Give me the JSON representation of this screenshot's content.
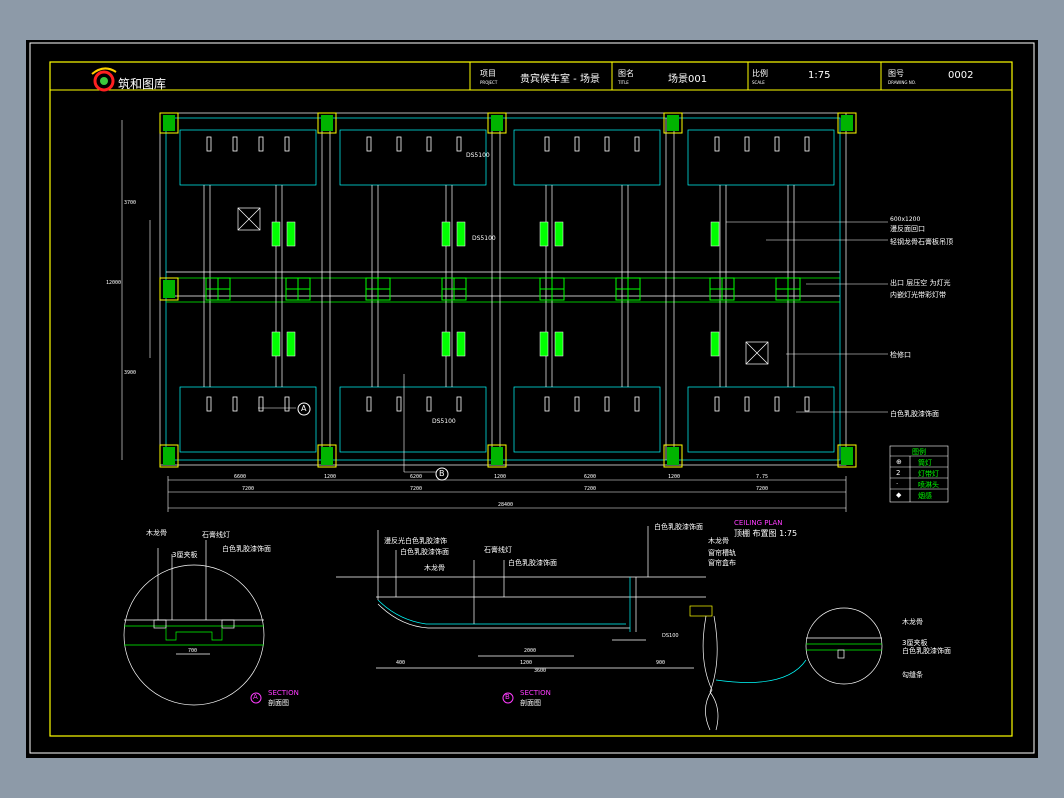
{
  "title_block": {
    "logo_text": "筑和图库",
    "project_label": "项目",
    "project_sub": "PROJECT",
    "project_value": "贵宾候车室 - 场景",
    "drawing_label": "图名",
    "drawing_sub": "TITLE",
    "drawing_value": "场景001",
    "scale_label": "比例",
    "scale_sub": "SCALE",
    "scale_value": "1:75",
    "number_label": "图号",
    "number_sub": "DRAWING NO.",
    "number_value": "0002"
  },
  "plan_labels": {
    "ds1": "DS5100",
    "ds2": "DS5100",
    "ds3": "DS5100",
    "callout_a": "A",
    "callout_b": "B"
  },
  "annotations": [
    {
      "key": "a1",
      "text": "600x1200"
    },
    {
      "key": "a2",
      "text": "漫反面回口"
    },
    {
      "key": "a3",
      "text": "轻钢龙骨石膏板吊顶"
    },
    {
      "key": "a4",
      "text": "出口 层压空 为灯光"
    },
    {
      "key": "a5",
      "text": "内嵌灯光带彩灯带"
    },
    {
      "key": "a6",
      "text": "检修口"
    },
    {
      "key": "a7",
      "text": "白色乳胶漆饰面"
    }
  ],
  "legend": {
    "title": "图例",
    "rows": [
      {
        "sym": "⊕",
        "label": "筒灯"
      },
      {
        "sym": "2",
        "label": "灯带灯"
      },
      {
        "sym": "·",
        "label": "喷淋头"
      },
      {
        "sym": "◆",
        "label": "烟感"
      }
    ]
  },
  "dimensions": {
    "total": "28400",
    "segs_top": [
      "6600",
      "1200",
      "6200",
      "1200",
      "6200",
      "1200",
      "7.75"
    ],
    "segs_bottom": [
      "7200",
      "7200",
      "7200",
      "7200"
    ],
    "left_total": "12000",
    "left_a": "3700",
    "left_b": "3900"
  },
  "section_a": {
    "letter": "A",
    "title": "SECTION",
    "subtitle": "剖面图",
    "notes": [
      "木龙骨",
      "石膏线灯",
      "3厘夹板",
      "白色乳胶漆饰面"
    ],
    "dim": "700"
  },
  "section_b": {
    "letter": "B",
    "title": "SECTION",
    "subtitle": "剖面图",
    "notes": [
      "漫反光白色乳胶漆饰",
      "白色乳胶漆饰面",
      "木龙骨",
      "石膏线灯",
      "白色乳胶漆饰面"
    ],
    "dims": [
      "400",
      "1200",
      "2000",
      "3600",
      "900"
    ],
    "ds": "DS100"
  },
  "ceiling_plan": {
    "title": "CEILING PLAN",
    "subtitle": "顶棚 布置图 1:75",
    "notes": [
      "白色乳胶漆饰面",
      "木龙骨",
      "窗帘槽轨",
      "窗帘盒布"
    ]
  },
  "detail_c": {
    "notes": [
      "木龙骨",
      "3厘夹板",
      "白色乳胶漆饰面",
      "勾缝条"
    ]
  },
  "colors": {
    "frame": "#ffff00",
    "line": "#ffffff",
    "accent": "#00ff00",
    "cyan": "#00ffff",
    "magenta": "#ff3cff",
    "red": "#ff2020"
  }
}
